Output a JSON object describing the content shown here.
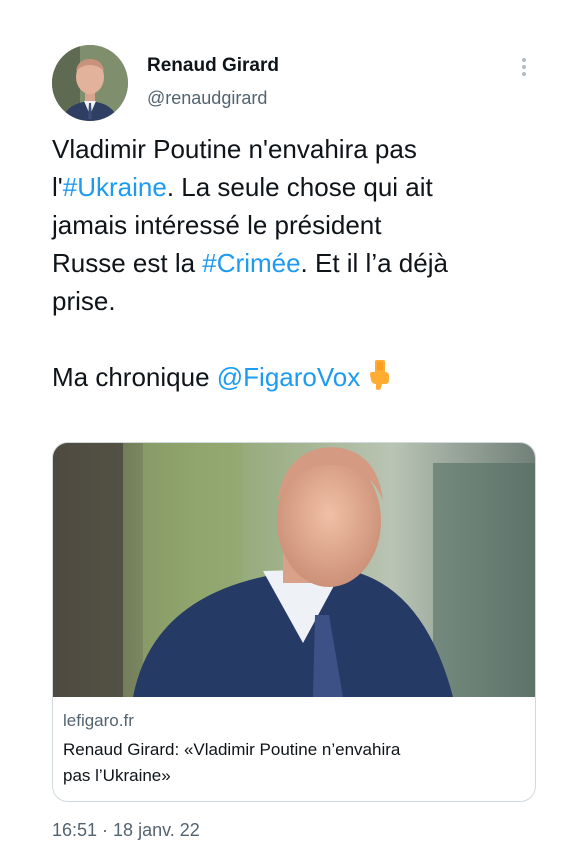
{
  "author": {
    "name": "Renaud Girard",
    "handle": "@renaudgirard",
    "avatar_icon": "profile-photo"
  },
  "more_icon": "more-options-vertical-dots",
  "tweet": {
    "line1": "Vladimir Poutine n'envahira pas",
    "line2_prefix": "l'",
    "line2_hashtag": "#Ukraine",
    "line2_suffix": ". La seule chose qui ait",
    "line3": "jamais intéressé le président",
    "line4_prefix": "Russe est la ",
    "line4_hashtag": "#Crimée",
    "line4_suffix": ". Et il l’a déjà",
    "line5": "prise.",
    "chronique_text": "Ma chronique ",
    "mention": "@FigaroVox",
    "emoji": "backhand-index-pointing-down"
  },
  "link_card": {
    "image": "photo-of-renaud-girard",
    "domain": "lefigaro.fr",
    "title_line1": "Renaud Girard: «Vladimir Poutine n’envahira",
    "title_line2": "pas l’Ukraine»"
  },
  "timestamp": {
    "time": "16:51",
    "separator": " · ",
    "date": "18 janv. 22"
  },
  "colors": {
    "link": "#1d9bf0",
    "text": "#0f1419",
    "secondary": "#536471",
    "border": "#cfd9de"
  }
}
